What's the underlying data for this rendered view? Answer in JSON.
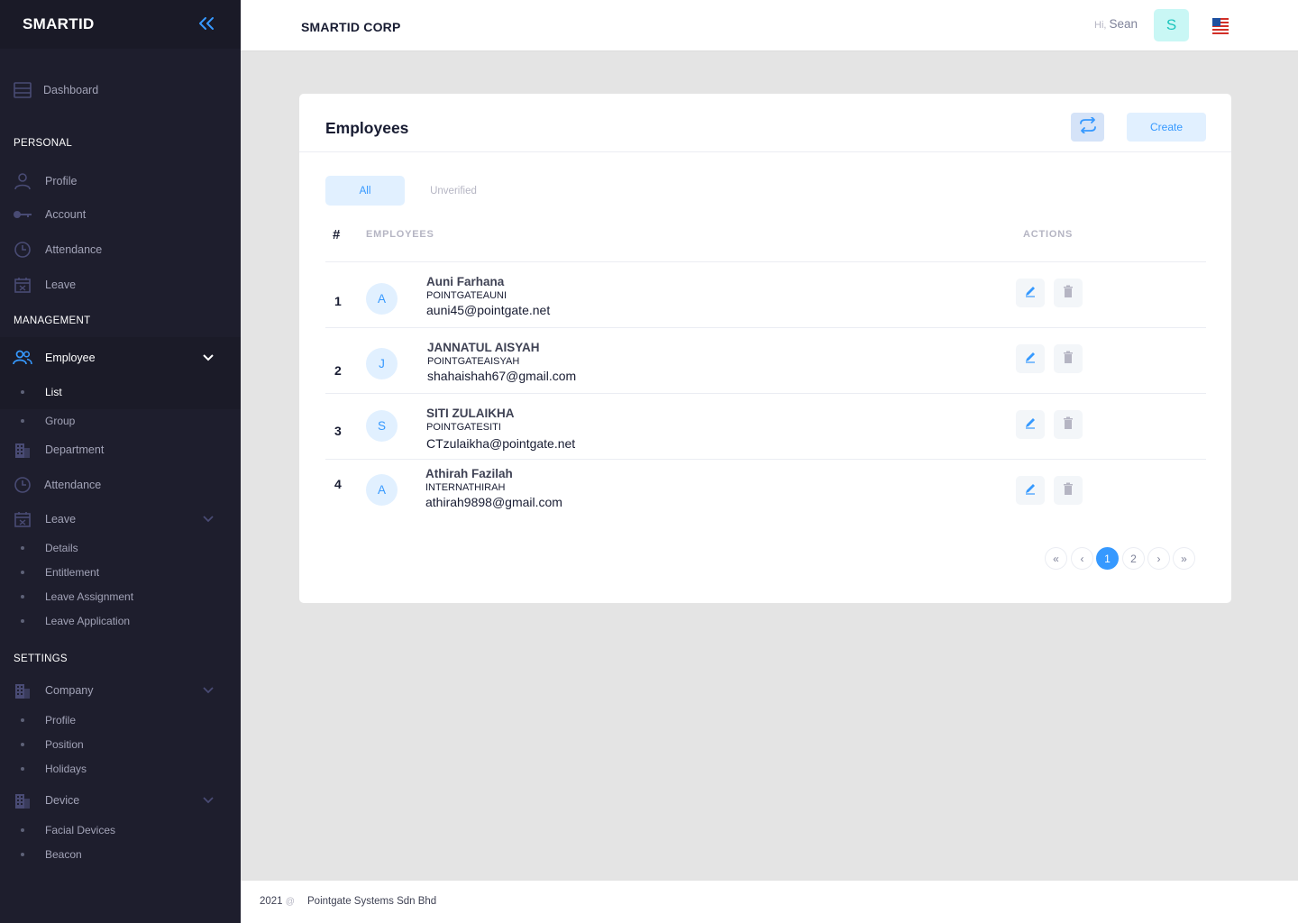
{
  "app": {
    "brand": "SMARTID",
    "company": "SMARTID CORP"
  },
  "user": {
    "greeting": "Hi,",
    "name": "Sean",
    "initial": "S"
  },
  "sidebar": {
    "dashboard": "Dashboard",
    "sections": {
      "personal": "PERSONAL",
      "management": "MANAGEMENT",
      "settings": "SETTINGS"
    },
    "personal": {
      "profile": "Profile",
      "account": "Account",
      "attendance": "Attendance",
      "leave": "Leave"
    },
    "management": {
      "employee": "Employee",
      "list": "List",
      "group": "Group",
      "department": "Department",
      "attendance": "Attendance",
      "leave": "Leave",
      "leave_details": "Details",
      "leave_entitlement": "Entitlement",
      "leave_assignment": "Leave Assignment",
      "leave_application": "Leave Application"
    },
    "settings": {
      "company": "Company",
      "profile": "Profile",
      "position": "Position",
      "holidays": "Holidays",
      "device": "Device",
      "facial_devices": "Facial Devices",
      "beacon": "Beacon"
    }
  },
  "card": {
    "title": "Employees",
    "create_label": "Create",
    "tabs": {
      "all": "All",
      "unverified": "Unverified"
    },
    "columns": {
      "num": "#",
      "employees": "EMPLOYEES",
      "actions": "ACTIONS"
    },
    "rows": [
      {
        "num": "1",
        "initial": "A",
        "name": "Auni Farhana",
        "username": "POINTGATEAUNI",
        "email": "auni45@pointgate.net"
      },
      {
        "num": "2",
        "initial": "J",
        "name": "JANNATUL AISYAH",
        "username": "POINTGATEAISYAH",
        "email": "shahaishah67@gmail.com"
      },
      {
        "num": "3",
        "initial": "S",
        "name": "SITI ZULAIKHA",
        "username": "POINTGATESITI",
        "email": "CTzulaikha@pointgate.net"
      },
      {
        "num": "4",
        "initial": "A",
        "name": "Athirah Fazilah",
        "username": "INTERNATHIRAH",
        "email": "athirah9898@gmail.com"
      }
    ],
    "pagination": {
      "first": "«",
      "prev": "‹",
      "pages": [
        "1",
        "2"
      ],
      "current": "1",
      "next": "›",
      "last": "»"
    }
  },
  "footer": {
    "year": "2021",
    "symbol": "@",
    "company": "Pointgate Systems Sdn Bhd"
  },
  "colors": {
    "primary": "#3699ff",
    "sidebar_bg": "#1e1e2d",
    "avatar_bg": "#c9f7f5"
  }
}
